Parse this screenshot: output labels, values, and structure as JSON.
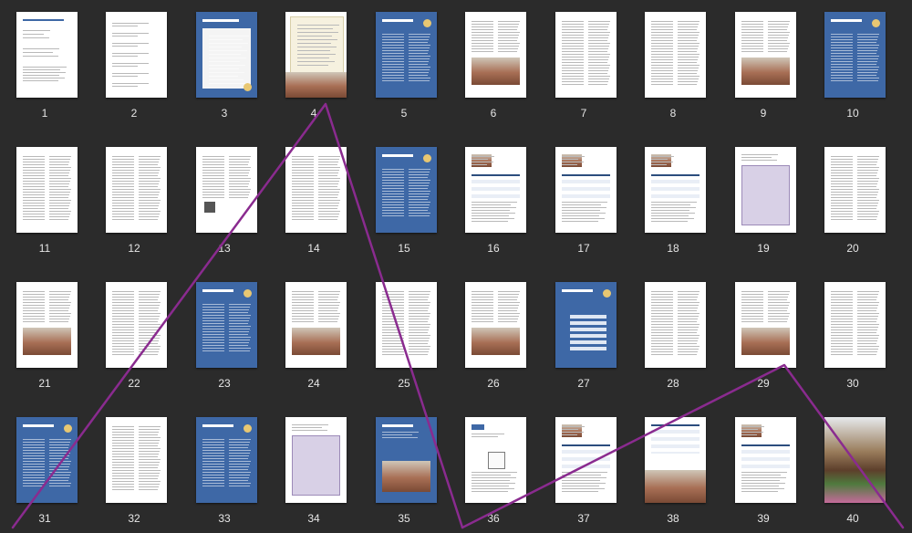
{
  "pages": [
    {
      "n": "1",
      "style": "toc"
    },
    {
      "n": "2",
      "style": "list"
    },
    {
      "n": "3",
      "style": "blue-letter"
    },
    {
      "n": "4",
      "style": "cream-photo"
    },
    {
      "n": "5",
      "style": "blue-text"
    },
    {
      "n": "6",
      "style": "text-photo"
    },
    {
      "n": "7",
      "style": "text"
    },
    {
      "n": "8",
      "style": "text"
    },
    {
      "n": "9",
      "style": "text-photo"
    },
    {
      "n": "10",
      "style": "blue-text"
    },
    {
      "n": "11",
      "style": "text"
    },
    {
      "n": "12",
      "style": "text"
    },
    {
      "n": "13",
      "style": "text-qr"
    },
    {
      "n": "14",
      "style": "text"
    },
    {
      "n": "15",
      "style": "blue-text"
    },
    {
      "n": "16",
      "style": "table"
    },
    {
      "n": "17",
      "style": "table"
    },
    {
      "n": "18",
      "style": "table"
    },
    {
      "n": "19",
      "style": "map"
    },
    {
      "n": "20",
      "style": "text"
    },
    {
      "n": "21",
      "style": "text-photo"
    },
    {
      "n": "22",
      "style": "text"
    },
    {
      "n": "23",
      "style": "blue-text"
    },
    {
      "n": "24",
      "style": "text-photo"
    },
    {
      "n": "25",
      "style": "text"
    },
    {
      "n": "26",
      "style": "text-photo"
    },
    {
      "n": "27",
      "style": "blue-table"
    },
    {
      "n": "28",
      "style": "text"
    },
    {
      "n": "29",
      "style": "text-photo"
    },
    {
      "n": "30",
      "style": "text"
    },
    {
      "n": "31",
      "style": "blue-text"
    },
    {
      "n": "32",
      "style": "text"
    },
    {
      "n": "33",
      "style": "blue-text"
    },
    {
      "n": "34",
      "style": "map"
    },
    {
      "n": "35",
      "style": "blue-photo"
    },
    {
      "n": "36",
      "style": "hand"
    },
    {
      "n": "37",
      "style": "table"
    },
    {
      "n": "38",
      "style": "table-photo"
    },
    {
      "n": "39",
      "style": "table"
    },
    {
      "n": "40",
      "style": "photo"
    }
  ],
  "colors": {
    "background": "#2b2b2b",
    "page": "#ffffff",
    "cover_blue": "#3e68a6",
    "page_number": "#e6e6e6",
    "annotation_stroke": "#8a2b8f"
  }
}
